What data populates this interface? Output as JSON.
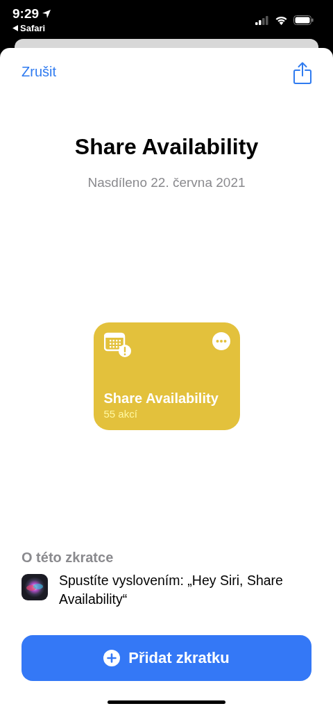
{
  "status_bar": {
    "time": "9:29",
    "back_app": "Safari"
  },
  "nav": {
    "cancel": "Zrušit"
  },
  "title": "Share Availability",
  "subtitle": "Nasdíleno 22. června 2021",
  "shortcut_card": {
    "name": "Share Availability",
    "actions": "55 akcí",
    "color": "#e3c13c"
  },
  "about": {
    "heading": "O této zkratce",
    "siri_phrase": "Spustíte vyslovením: „Hey Siri, Share Availability“"
  },
  "add_button": "Přidat zkratku"
}
